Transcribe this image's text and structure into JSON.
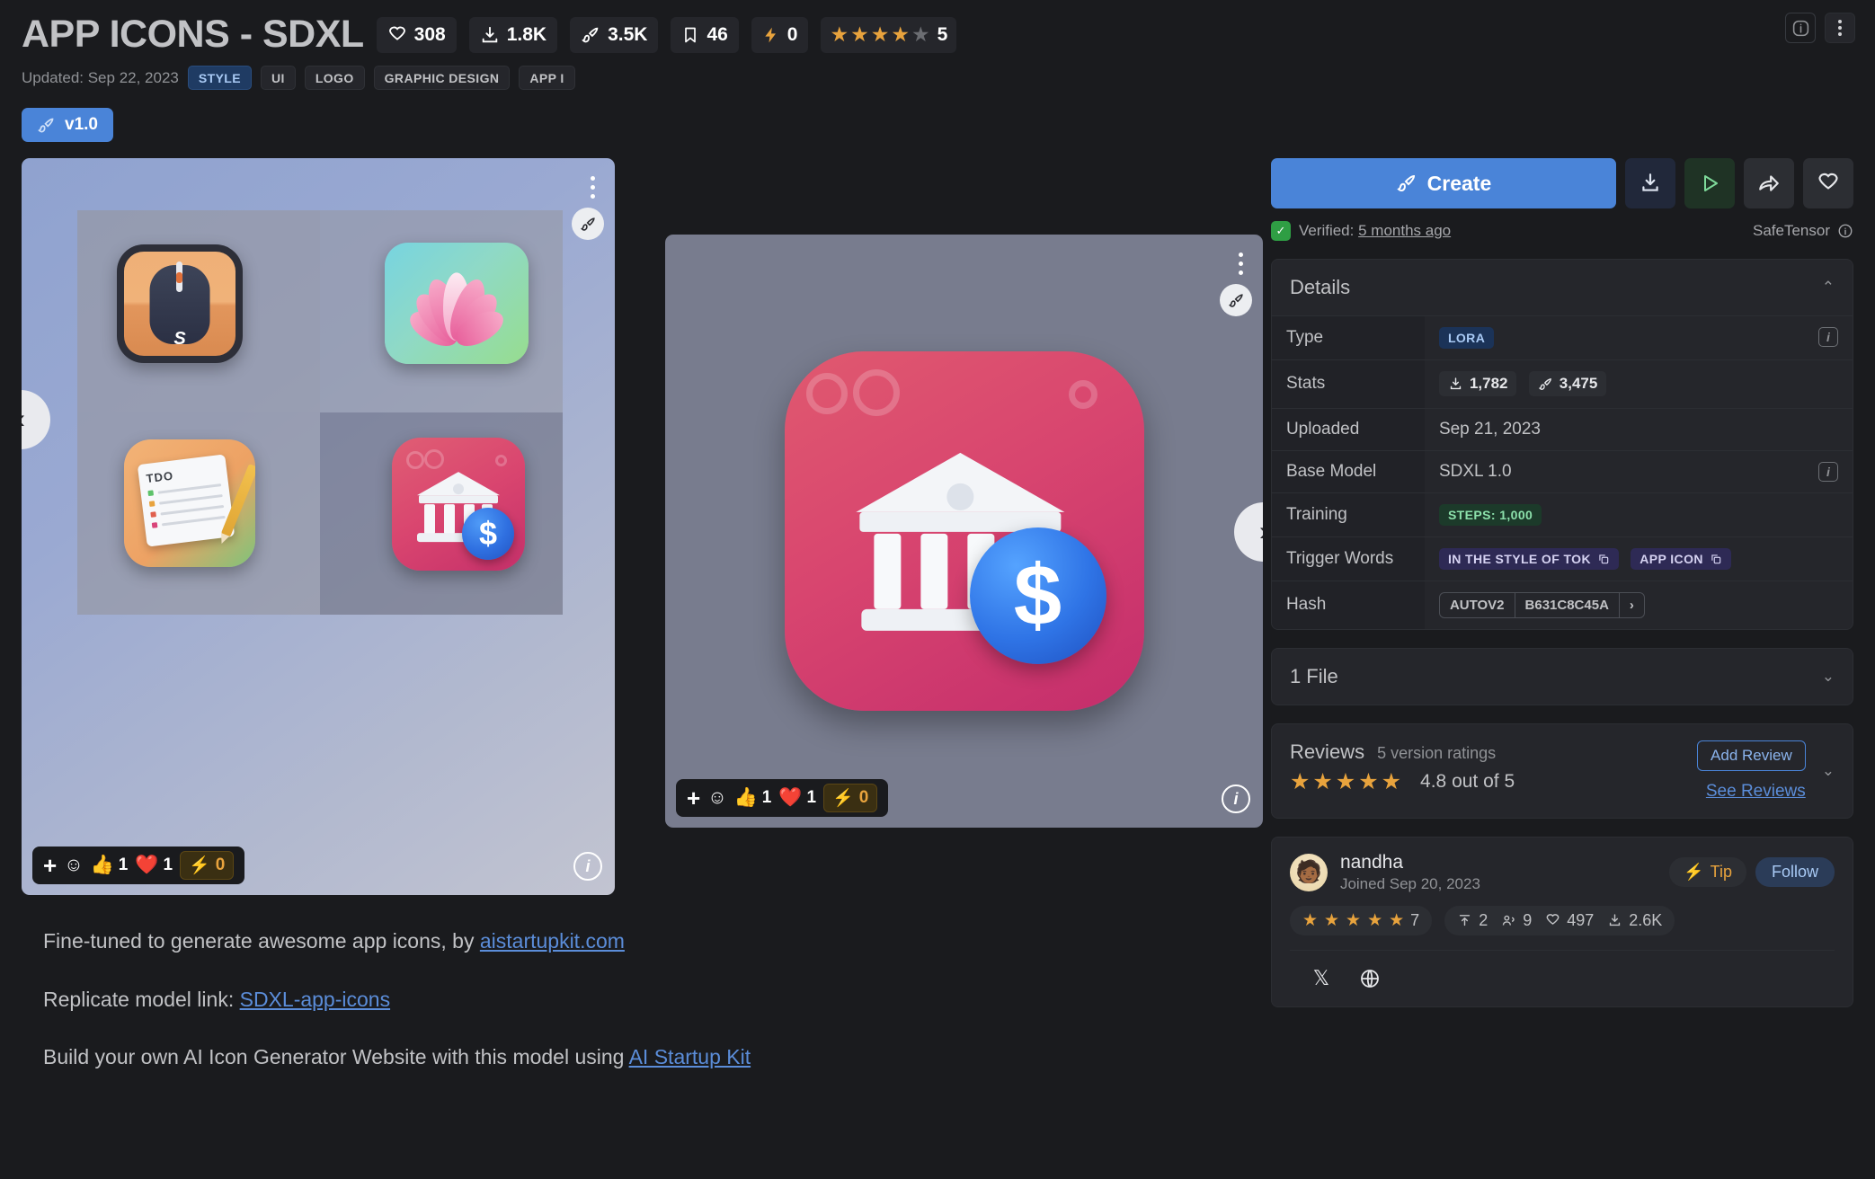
{
  "header": {
    "title": "APP ICONS - SDXL",
    "stats": [
      {
        "icon": "heart-icon",
        "value": "308"
      },
      {
        "icon": "download-icon",
        "value": "1.8K"
      },
      {
        "icon": "brush-icon",
        "value": "3.5K"
      },
      {
        "icon": "bookmark-icon",
        "value": "46"
      },
      {
        "icon": "lightning-icon",
        "value": "0"
      }
    ],
    "rating": {
      "stars_filled": 4,
      "stars_total": 5,
      "count": "5"
    },
    "updated": "Updated: Sep 22, 2023",
    "tags": [
      {
        "label": "STYLE",
        "active": true
      },
      {
        "label": "UI",
        "active": false
      },
      {
        "label": "LOGO",
        "active": false
      },
      {
        "label": "GRAPHIC DESIGN",
        "active": false
      },
      {
        "label": "APP I",
        "active": false
      }
    ],
    "version": "v1.0"
  },
  "gallery": {
    "image_one": {
      "alt": "grid of four generated app icons: mouse, lotus flower, todo notepad, bank",
      "note_header": "TDO",
      "mouse_letter": "S",
      "coin_symbol": "$",
      "reactions": {
        "thumbs": "1",
        "heart": "1",
        "buzz": "0"
      }
    },
    "image_two": {
      "alt": "large pink bank app icon with dollar coin",
      "coin_symbol": "$",
      "reactions": {
        "thumbs": "1",
        "heart": "1",
        "buzz": "0"
      }
    }
  },
  "description": {
    "line1_pre": "Fine-tuned to generate awesome app icons, by ",
    "line1_link": "aistartupkit.com",
    "line2_pre": "Replicate model link: ",
    "line2_link": "SDXL-app-icons",
    "line3_pre": "Build your own AI Icon Generator Website with this model using ",
    "line3_link": "AI Startup Kit"
  },
  "sidebar": {
    "create_label": "Create",
    "verified_label": "Verified:",
    "verified_time": "5 months ago",
    "safetensor_label": "SafeTensor",
    "details": {
      "heading": "Details",
      "rows": [
        {
          "key": "Type",
          "value": "LORA",
          "kind": "pill-lora",
          "info": true
        },
        {
          "key": "Stats",
          "downloads": "1,782",
          "generations": "3,475",
          "kind": "stats",
          "info": false
        },
        {
          "key": "Uploaded",
          "value": "Sep 21, 2023",
          "kind": "text",
          "info": false
        },
        {
          "key": "Base Model",
          "value": "SDXL 1.0",
          "kind": "text",
          "info": true
        },
        {
          "key": "Training",
          "value": "STEPS: 1,000",
          "kind": "pill-steps",
          "info": false
        },
        {
          "key": "Trigger Words",
          "words": [
            "IN THE STYLE OF TOK",
            "APP ICON"
          ],
          "kind": "pill-trigger",
          "info": false
        },
        {
          "key": "Hash",
          "algo": "AUTOV2",
          "value": "B631C8C45A",
          "kind": "hash",
          "info": false
        }
      ]
    },
    "files": {
      "heading": "1 File"
    },
    "reviews": {
      "heading": "Reviews",
      "version_ratings": "5 version ratings",
      "stars_filled": 5,
      "score_text": "4.8 out of 5",
      "add_review": "Add Review",
      "see_reviews": "See Reviews"
    },
    "creator": {
      "name": "nandha",
      "joined": "Joined Sep 20, 2023",
      "tip_label": "Tip",
      "follow_label": "Follow",
      "rating_count": "7",
      "uploads": "2",
      "followers": "9",
      "likes": "497",
      "downloads": "2.6K",
      "socials": [
        "x-icon",
        "globe-icon"
      ]
    }
  },
  "colors": {
    "accent_blue": "#4a84d8",
    "star_orange": "#e8a33d",
    "bg": "#1a1b1e",
    "card_bg": "#25262b",
    "link": "#5b8dd9"
  }
}
